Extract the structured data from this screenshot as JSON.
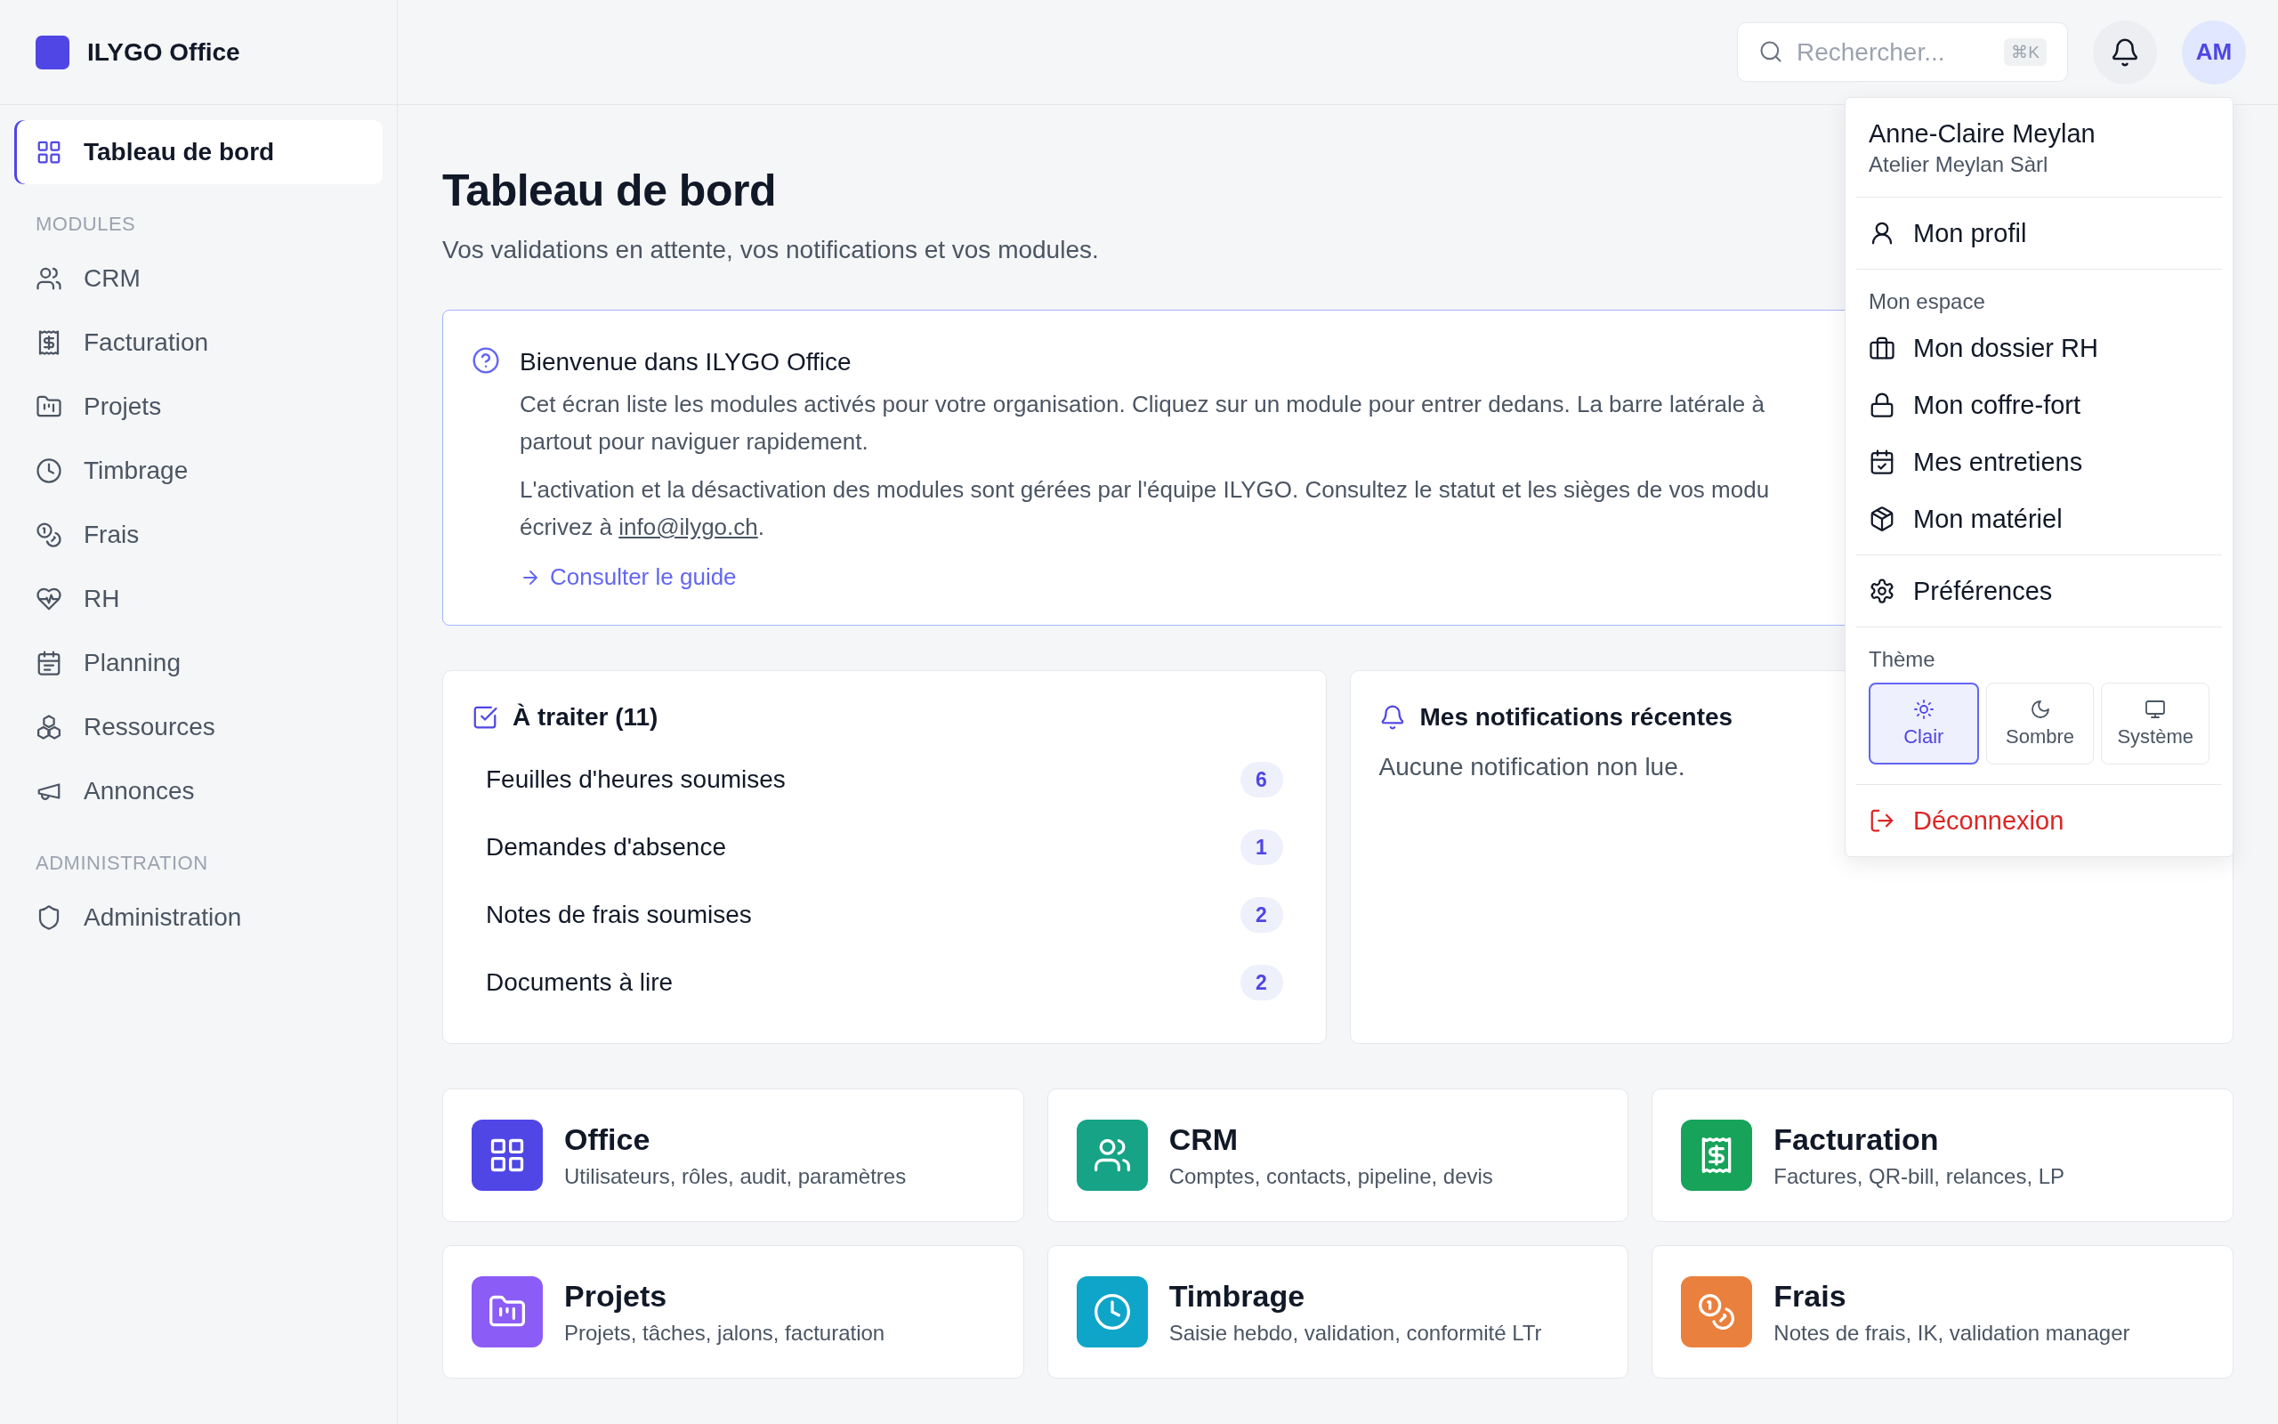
{
  "app": {
    "name": "ILYGO Office"
  },
  "sidebar": {
    "top": {
      "label": "Tableau de bord",
      "kind": "grid",
      "selected": true
    },
    "sections": [
      {
        "title": "MODULES",
        "items": [
          {
            "label": "CRM",
            "kind": "users",
            "selected": false
          },
          {
            "label": "Facturation",
            "kind": "receipt",
            "selected": false
          },
          {
            "label": "Projets",
            "kind": "folder",
            "selected": false
          },
          {
            "label": "Timbrage",
            "kind": "clock",
            "selected": false
          },
          {
            "label": "Frais",
            "kind": "coins",
            "selected": false
          },
          {
            "label": "RH",
            "kind": "heart",
            "selected": false
          },
          {
            "label": "Planning",
            "kind": "calendar",
            "selected": false
          },
          {
            "label": "Ressources",
            "kind": "cubes",
            "selected": false
          },
          {
            "label": "Annonces",
            "kind": "megaphone",
            "selected": false
          }
        ]
      },
      {
        "title": "ADMINISTRATION",
        "items": [
          {
            "label": "Administration",
            "kind": "shield",
            "selected": false
          }
        ]
      }
    ]
  },
  "header": {
    "search": {
      "placeholder": "Rechercher...",
      "shortcut": "⌘K"
    },
    "avatar": {
      "initials": "AM"
    }
  },
  "page": {
    "title": "Tableau de bord",
    "subtitle": "Vos validations en attente, vos notifications et vos modules."
  },
  "welcome": {
    "title": "Bienvenue dans ILYGO Office",
    "paragraphs": [
      {
        "lines": [
          "Cet écran liste les modules activés pour votre organisation. Cliquez sur un module pour entrer dedans. La barre latérale à",
          "partout pour naviguer rapidement."
        ]
      },
      {
        "lines": [
          "L'activation et la désactivation des modules sont gérées par l'équipe ILYGO. Consultez le statut et les sièges de vos modu"
        ],
        "closing": {
          "before": "écrivez à",
          "email": "info@ilygo.ch",
          "after": "."
        }
      }
    ],
    "link": "Consulter le guide"
  },
  "todo": {
    "title": "À traiter (11)",
    "items": [
      {
        "label": "Feuilles d'heures soumises",
        "count": "6"
      },
      {
        "label": "Demandes d'absence",
        "count": "1"
      },
      {
        "label": "Notes de frais soumises",
        "count": "2"
      },
      {
        "label": "Documents à lire",
        "count": "2"
      }
    ]
  },
  "notifications": {
    "title": "Mes notifications récentes",
    "empty": "Aucune notification non lue."
  },
  "modules": [
    {
      "title": "Office",
      "description": "Utilisateurs, rôles, audit, paramètres",
      "kind": "grid",
      "color": "#4f46e5"
    },
    {
      "title": "CRM",
      "description": "Comptes, contacts, pipeline, devis",
      "kind": "users",
      "color": "#16a386"
    },
    {
      "title": "Facturation",
      "description": "Factures, QR-bill, relances, LP",
      "kind": "receipt",
      "color": "#17a35a"
    },
    {
      "title": "Projets",
      "description": "Projets, tâches, jalons, facturation",
      "kind": "folder",
      "color": "#8b5cf6"
    },
    {
      "title": "Timbrage",
      "description": "Saisie hebdo, validation, conformité LTr",
      "kind": "clock",
      "color": "#0fa5c9"
    },
    {
      "title": "Frais",
      "description": "Notes de frais, IK, validation manager",
      "kind": "coins",
      "color": "#ea803d"
    }
  ],
  "user_menu": {
    "name": "Anne-Claire Meylan",
    "organization": "Atelier Meylan Sàrl",
    "groups": [
      {
        "items": [
          {
            "label": "Mon profil",
            "kind": "user"
          }
        ]
      },
      {
        "heading": "Mon espace",
        "items": [
          {
            "label": "Mon dossier RH",
            "kind": "briefcase"
          },
          {
            "label": "Mon coffre-fort",
            "kind": "lock"
          },
          {
            "label": "Mes entretiens",
            "kind": "calcheck"
          },
          {
            "label": "Mon matériel",
            "kind": "package"
          }
        ]
      },
      {
        "items": [
          {
            "label": "Préférences",
            "kind": "gear"
          }
        ]
      }
    ],
    "theme": {
      "title": "Thème",
      "options": [
        {
          "label": "Clair",
          "kind": "sun",
          "selected": true
        },
        {
          "label": "Sombre",
          "kind": "moon",
          "selected": false
        },
        {
          "label": "Système",
          "kind": "monitor",
          "selected": false
        }
      ]
    },
    "logout": {
      "label": "Déconnexion"
    }
  }
}
